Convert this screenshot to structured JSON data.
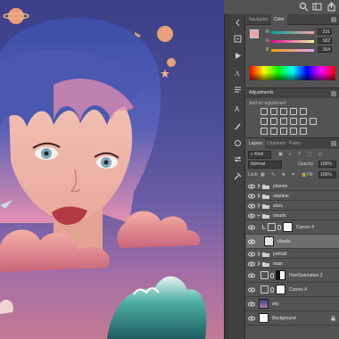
{
  "topbar": {
    "icons": [
      "search-icon",
      "workspace-icon",
      "share-icon"
    ]
  },
  "panel_tabs": {
    "navigator": "Navigator",
    "color": "Color"
  },
  "color": {
    "foreground_hex": "#e7a2a4",
    "background_hex": "#f4f4f4",
    "sliders": [
      {
        "label": "R",
        "value": "231"
      },
      {
        "label": "G",
        "value": "162"
      },
      {
        "label": "B",
        "value": "164"
      }
    ]
  },
  "adjustments": {
    "title": "Adjustments",
    "subtitle": "Add an adjustment"
  },
  "layers_tabs": {
    "layers": "Layers",
    "channels": "Channels",
    "paths": "Paths"
  },
  "layers_panel": {
    "kind_label": "Kind",
    "blend_mode": "Normal",
    "opacity_label": "Opacity:",
    "opacity_value": "100%",
    "lock_label": "Lock:",
    "fill_label": "Fill:",
    "fill_value": "100%"
  },
  "layers": [
    {
      "name": "planets",
      "type": "group"
    },
    {
      "name": "airplane",
      "type": "group"
    },
    {
      "name": "stars",
      "type": "group"
    },
    {
      "name": "clouds",
      "type": "group"
    },
    {
      "name": "Curves 4",
      "type": "adjustment"
    },
    {
      "name": "clouds",
      "type": "pixel",
      "selected": true
    },
    {
      "name": "portrait",
      "type": "group"
    },
    {
      "name": "main",
      "type": "group"
    },
    {
      "name": "Hue/Saturation 3",
      "type": "adjustment"
    },
    {
      "name": "Curves 4",
      "type": "adjustment"
    },
    {
      "name": "sky",
      "type": "pixel"
    },
    {
      "name": "Background",
      "type": "pixel"
    }
  ],
  "accent_colors": {
    "sky_top": "#3a3f86",
    "hair_blue": "#3b4fa8",
    "hair_pink": "#e18aa8",
    "cloud_pink": "#e8919a",
    "wave_teal": "#2f8d84"
  }
}
